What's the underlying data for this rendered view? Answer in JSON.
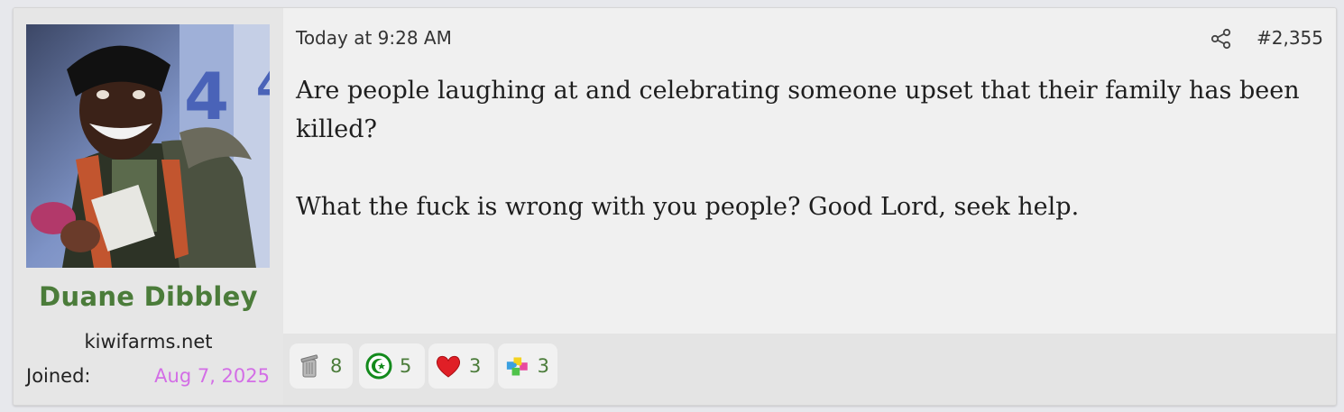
{
  "post": {
    "date": "Today at 9:28 AM",
    "number": "#2,355",
    "paragraphs": [
      "Are people laughing at and celebrating someone upset that their family has been killed?",
      "What the fuck is wrong with you people? Good Lord, seek help."
    ]
  },
  "user": {
    "name": "Duane Dibbley",
    "title": "kiwifarms.net",
    "joined_label": "Joined:",
    "joined_date": "Aug 7, 2025",
    "name_color": "#4b7c3a",
    "joined_color": "#d36ee6"
  },
  "reactions": [
    {
      "icon": "trash-can-icon",
      "count": "8"
    },
    {
      "icon": "green-star-badge-icon",
      "count": "5"
    },
    {
      "icon": "heart-icon",
      "count": "3"
    },
    {
      "icon": "puzzle-pieces-icon",
      "count": "3"
    }
  ]
}
